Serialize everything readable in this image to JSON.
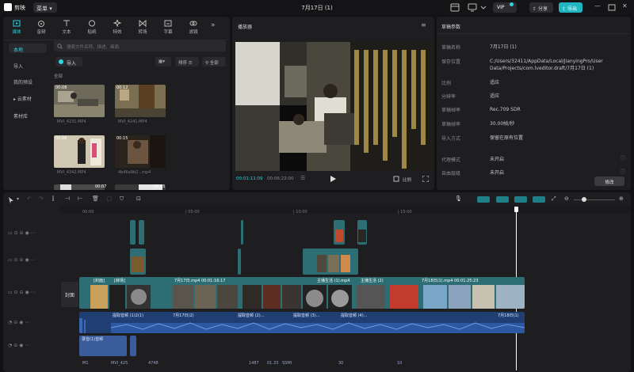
{
  "titlebar": {
    "app_name": "剪映",
    "menu_label": "菜单",
    "window_title": "7月17日 (1)",
    "vip_label": "VIP",
    "share_label": "分享",
    "export_label": "导出"
  },
  "media": {
    "tabs": [
      {
        "label": "媒体",
        "icon": "media-icon"
      },
      {
        "label": "音频",
        "icon": "audio-icon"
      },
      {
        "label": "文本",
        "icon": "text-icon"
      },
      {
        "label": "贴纸",
        "icon": "sticker-icon"
      },
      {
        "label": "特效",
        "icon": "effects-icon"
      },
      {
        "label": "转场",
        "icon": "transition-icon"
      },
      {
        "label": "字幕",
        "icon": "caption-icon"
      },
      {
        "label": "滤镜",
        "icon": "filter-icon"
      }
    ],
    "sidebar": [
      "本地",
      "导入",
      "我的预设",
      "云素材",
      "素材库"
    ],
    "search_placeholder": "搜索文件名称、描述、画面",
    "import_label": "导入",
    "sort_label": "排序",
    "filter_label": "全部",
    "section_label": "全部",
    "thumbs": [
      {
        "caption": "MVI_4231.MP4",
        "duration": "00:08"
      },
      {
        "caption": "MVI_4241.MP4",
        "duration": "00:12"
      },
      {
        "caption": "MVI_4342.MP4",
        "duration": "00:06"
      },
      {
        "caption": "4b46a9b2...mp4",
        "duration": "00:15"
      },
      {
        "caption": "",
        "duration": "00:07"
      },
      {
        "caption": "",
        "duration": "00:05"
      }
    ]
  },
  "player": {
    "title": "播放器",
    "time_current": "00:01:11:09",
    "time_total": "00:06:22:00",
    "ratio_label": "比例"
  },
  "details": {
    "title": "草稿参数",
    "rows": [
      {
        "label": "草稿名称",
        "value": "7月17日 (1)"
      },
      {
        "label": "保存位置",
        "value": "C:/Users/32411/AppData/Local/JianyingPro/User Data/Projects/com.lveditor.draft/7月17日 (1)"
      },
      {
        "label": "比例",
        "value": "适应"
      },
      {
        "label": "分辨率",
        "value": "适应"
      },
      {
        "label": "草稿帧率",
        "value": "Rec.709 SDR"
      },
      {
        "label": "草稿帧率",
        "value": "30.00帧/秒"
      },
      {
        "label": "导入方式",
        "value": "保留在原有位置"
      },
      {
        "label": "代理模式",
        "value": "未开启"
      },
      {
        "label": "自由层级",
        "value": "未开启"
      }
    ],
    "modify_label": "修改"
  },
  "timeline": {
    "ruler": [
      "00:00",
      "| 05:00",
      "| 10:00",
      "| 15:00"
    ],
    "cover_label": "封面",
    "main_clips": [
      {
        "label": "[封面]"
      },
      {
        "label": "[转场]"
      },
      {
        "label": "7月17日.mp4  00:01:16:17"
      },
      {
        "label": "主播生活 (1).mp4"
      },
      {
        "label": "主播生活 (2)"
      },
      {
        "label": "7月18日(1).mp4  00:01:25:23"
      }
    ],
    "audio_clips": [
      {
        "label": "提取音频 (1)2(1)"
      },
      {
        "label": "7月17日(2)"
      },
      {
        "label": "提取音频 (2)..."
      },
      {
        "label": "提取音频 (3)..."
      },
      {
        "label": "提取音频 (4)..."
      },
      {
        "label": "7月18日(1)"
      }
    ],
    "voice_label": "录音(1)音频",
    "bottom_labels": [
      "M1",
      "MVI_425",
      "4748",
      "1487",
      "01.33",
      "SSMI",
      "30",
      "10"
    ]
  }
}
